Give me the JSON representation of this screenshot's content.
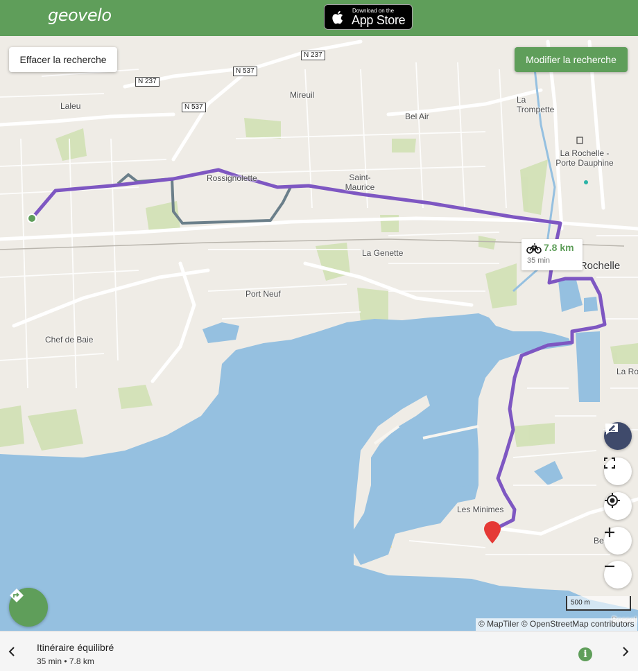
{
  "header": {
    "logo": "geovelo",
    "appstore": {
      "small": "Download on the",
      "big": "App Store"
    }
  },
  "controls": {
    "clear_label": "Effacer la recherche",
    "modify_label": "Modifier la recherche"
  },
  "route": {
    "distance": "7.8 km",
    "duration": "35 min"
  },
  "map": {
    "places": [
      "Laleu",
      "Mireuil",
      "La Trompette",
      "Bel Air",
      "La Rochelle - Porte Dauphine",
      "Rossignolette",
      "Saint-Maurice",
      "La Genette",
      "La Rochelle",
      "Port Neuf",
      "Chef de Baie",
      "Les Minimes",
      "La Roche",
      "Bel",
      "Bessel"
    ],
    "roads": [
      "N 237",
      "N 537"
    ],
    "scale": "500 m",
    "attribution": "© MapTiler © OpenStreetMap contributors"
  },
  "footer": {
    "title": "Itinéraire équilibré",
    "subtitle": "35 min • 7.8 km",
    "info": "i"
  },
  "colors": {
    "brand": "#5f9e5a",
    "route": "#7e57c2",
    "alt_route": "#6b7f8a",
    "water": "#95c0e0",
    "dest_marker": "#e53935"
  },
  "icons": [
    "apple-icon",
    "bicycle-icon",
    "feedback-icon",
    "fullscreen-icon",
    "locate-icon",
    "plus-icon",
    "minus-icon",
    "directions-icon",
    "chevron-left-icon",
    "chevron-right-icon",
    "info-icon",
    "destination-marker-icon",
    "origin-marker-icon"
  ]
}
